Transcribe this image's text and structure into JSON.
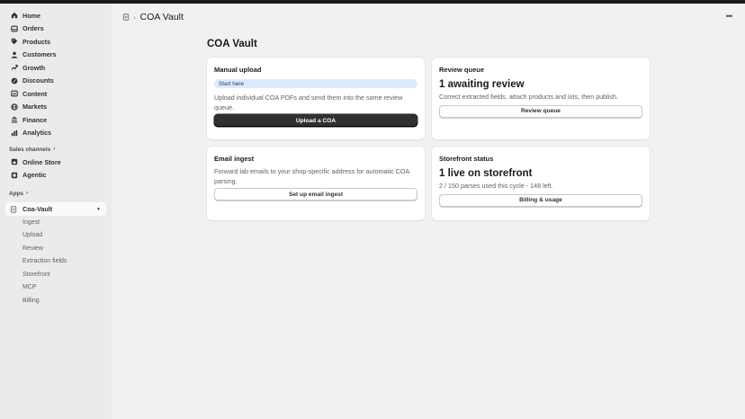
{
  "sidebar": {
    "items": [
      {
        "label": "Home",
        "icon": "home-icon"
      },
      {
        "label": "Orders",
        "icon": "inbox-icon"
      },
      {
        "label": "Products",
        "icon": "tag-icon"
      },
      {
        "label": "Customers",
        "icon": "person-icon"
      },
      {
        "label": "Growth",
        "icon": "growth-icon"
      },
      {
        "label": "Discounts",
        "icon": "discount-icon"
      },
      {
        "label": "Content",
        "icon": "content-icon"
      },
      {
        "label": "Markets",
        "icon": "globe-icon"
      },
      {
        "label": "Finance",
        "icon": "bank-icon"
      },
      {
        "label": "Analytics",
        "icon": "chart-icon"
      }
    ],
    "sales_channels_label": "Sales channels",
    "channels": [
      {
        "label": "Online Store",
        "icon": "store-icon"
      },
      {
        "label": "Agentic",
        "icon": "agentic-icon"
      }
    ],
    "apps_label": "Apps",
    "active_app": "Coa-Vault",
    "app_subitems": [
      "Ingest",
      "Upload",
      "Review",
      "Extraction fields",
      "Storefront",
      "MCP",
      "Billing"
    ]
  },
  "header": {
    "title": "COA Vault"
  },
  "page": {
    "title": "COA Vault"
  },
  "cards": {
    "manual_upload": {
      "title": "Manual upload",
      "badge": "Start here",
      "description": "Upload individual COA PDFs and send them into the same review queue.",
      "button": "Upload a COA"
    },
    "review_queue": {
      "title": "Review queue",
      "stat": "1 awaiting review",
      "description": "Correct extracted fields, attach products and lots, then publish.",
      "button": "Review queue"
    },
    "email_ingest": {
      "title": "Email ingest",
      "description": "Forward lab emails to your shop-specific address for automatic COA parsing.",
      "button": "Set up email ingest"
    },
    "storefront_status": {
      "title": "Storefront status",
      "stat": "1 live on storefront",
      "description": "2 / 150 parses used this cycle - 148 left.",
      "button": "Billing & usage"
    }
  }
}
